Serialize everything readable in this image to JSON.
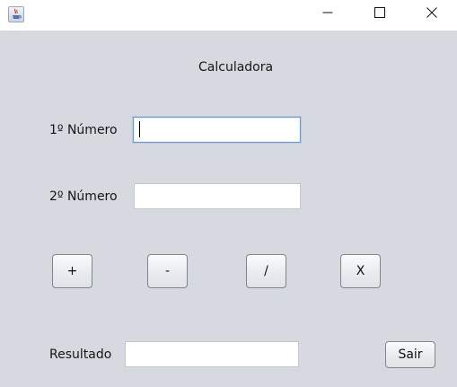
{
  "window": {
    "icon": "java-cup-icon",
    "controls": [
      "minimize-icon",
      "maximize-icon",
      "close-icon"
    ]
  },
  "form": {
    "title": "Calculadora",
    "number1_label": "1º Número",
    "number1_value": "",
    "number2_label": "2º Número",
    "number2_value": "",
    "operations": {
      "add": "+",
      "subtract": "-",
      "divide": "/",
      "multiply": "X"
    },
    "result_label": "Resultado",
    "result_value": "",
    "exit_label": "Sair"
  }
}
